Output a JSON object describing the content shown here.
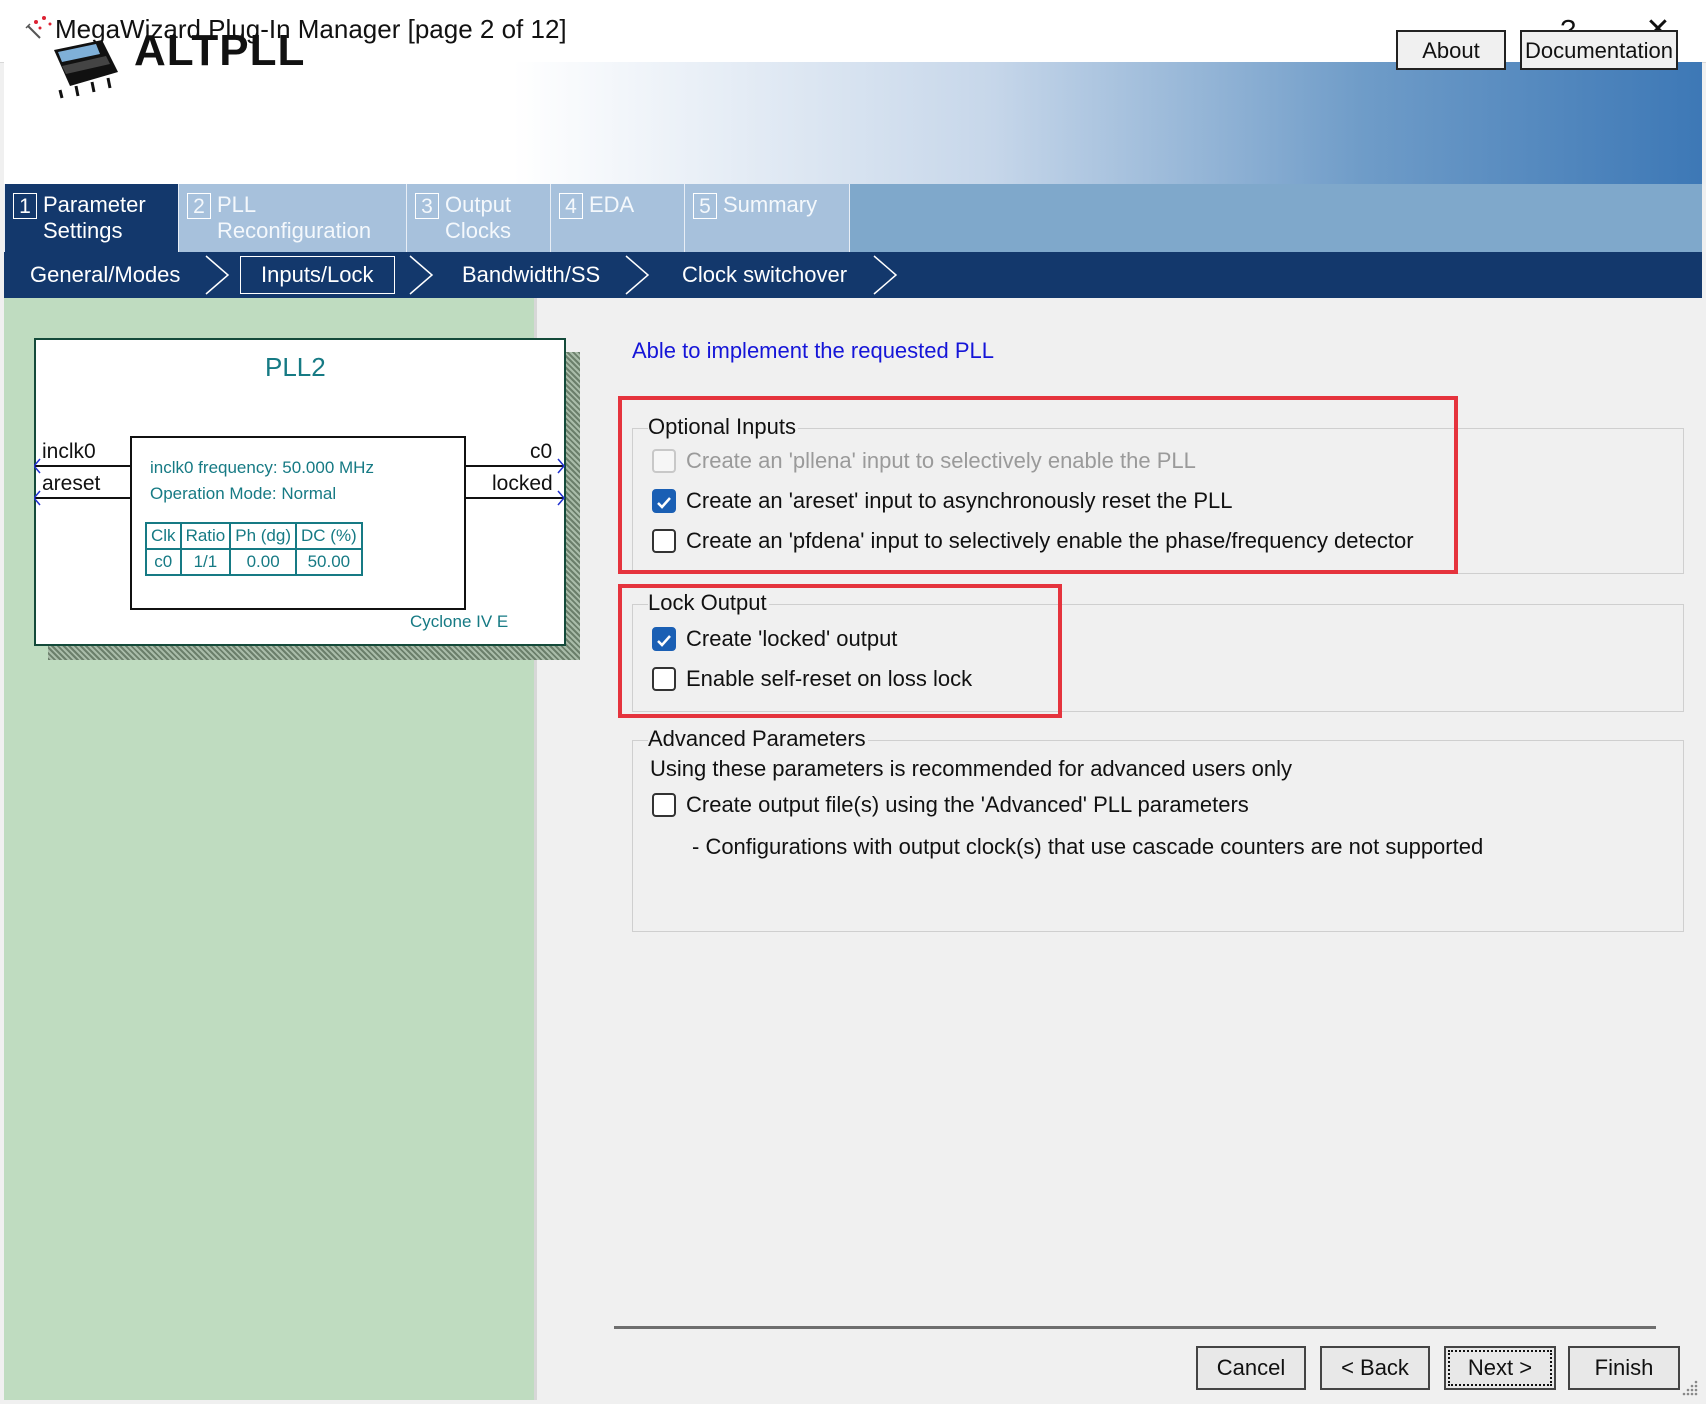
{
  "window": {
    "title": "MegaWizard Plug-In Manager [page 2 of 12]",
    "help_label": "?",
    "close_label": "✕"
  },
  "header": {
    "product": "ALTPLL",
    "about_label": "About",
    "documentation_label": "Documentation"
  },
  "tabs": [
    {
      "num": "1",
      "label": "Parameter Settings",
      "active": true
    },
    {
      "num": "2",
      "label": "PLL Reconfiguration",
      "active": false
    },
    {
      "num": "3",
      "label": "Output Clocks",
      "active": false
    },
    {
      "num": "4",
      "label": "EDA",
      "active": false
    },
    {
      "num": "5",
      "label": "Summary",
      "active": false
    }
  ],
  "subtabs": [
    {
      "label": "General/Modes",
      "active": false
    },
    {
      "label": "Inputs/Lock",
      "active": true
    },
    {
      "label": "Bandwidth/SS",
      "active": false
    },
    {
      "label": "Clock switchover",
      "active": false
    }
  ],
  "diagram": {
    "title": "PLL2",
    "inputs": [
      "inclk0",
      "areset"
    ],
    "outputs": [
      "c0",
      "locked"
    ],
    "freq_text": "inclk0 frequency: 50.000 MHz",
    "mode_text": "Operation Mode: Normal",
    "table_headers": [
      "Clk",
      "Ratio",
      "Ph (dg)",
      "DC (%)"
    ],
    "table_row": [
      "c0",
      "1/1",
      "0.00",
      "50.00"
    ],
    "device": "Cyclone IV E"
  },
  "status_text": "Able to implement the requested PLL",
  "optional_inputs": {
    "legend": "Optional Inputs",
    "options": [
      {
        "label": "Create an 'pllena' input to selectively enable the PLL",
        "checked": false,
        "disabled": true
      },
      {
        "label": "Create an 'areset' input to asynchronously reset the PLL",
        "checked": true,
        "disabled": false
      },
      {
        "label": "Create an 'pfdena' input to selectively enable the phase/frequency detector",
        "checked": false,
        "disabled": false
      }
    ]
  },
  "lock_output": {
    "legend": "Lock Output",
    "options": [
      {
        "label": "Create 'locked' output",
        "checked": true,
        "disabled": false
      },
      {
        "label": "Enable self-reset on loss lock",
        "checked": false,
        "disabled": false
      }
    ]
  },
  "advanced": {
    "legend": "Advanced Parameters",
    "note": "Using these parameters is recommended for advanced users only",
    "option": {
      "label": "Create output file(s) using the 'Advanced' PLL parameters",
      "checked": false
    },
    "footnote": "- Configurations with output clock(s) that use cascade counters are not supported"
  },
  "footer": {
    "cancel_label": "Cancel",
    "back_label": "< Back",
    "next_label": "Next >",
    "finish_label": "Finish"
  },
  "colors": {
    "tab_active": "#13386c",
    "tab_inactive": "#a7c1dc",
    "left_pane": "#bfdcc0",
    "status_text": "#1515d8",
    "highlight_box": "#e5333d",
    "checkbox_checked": "#1a5fb4"
  }
}
